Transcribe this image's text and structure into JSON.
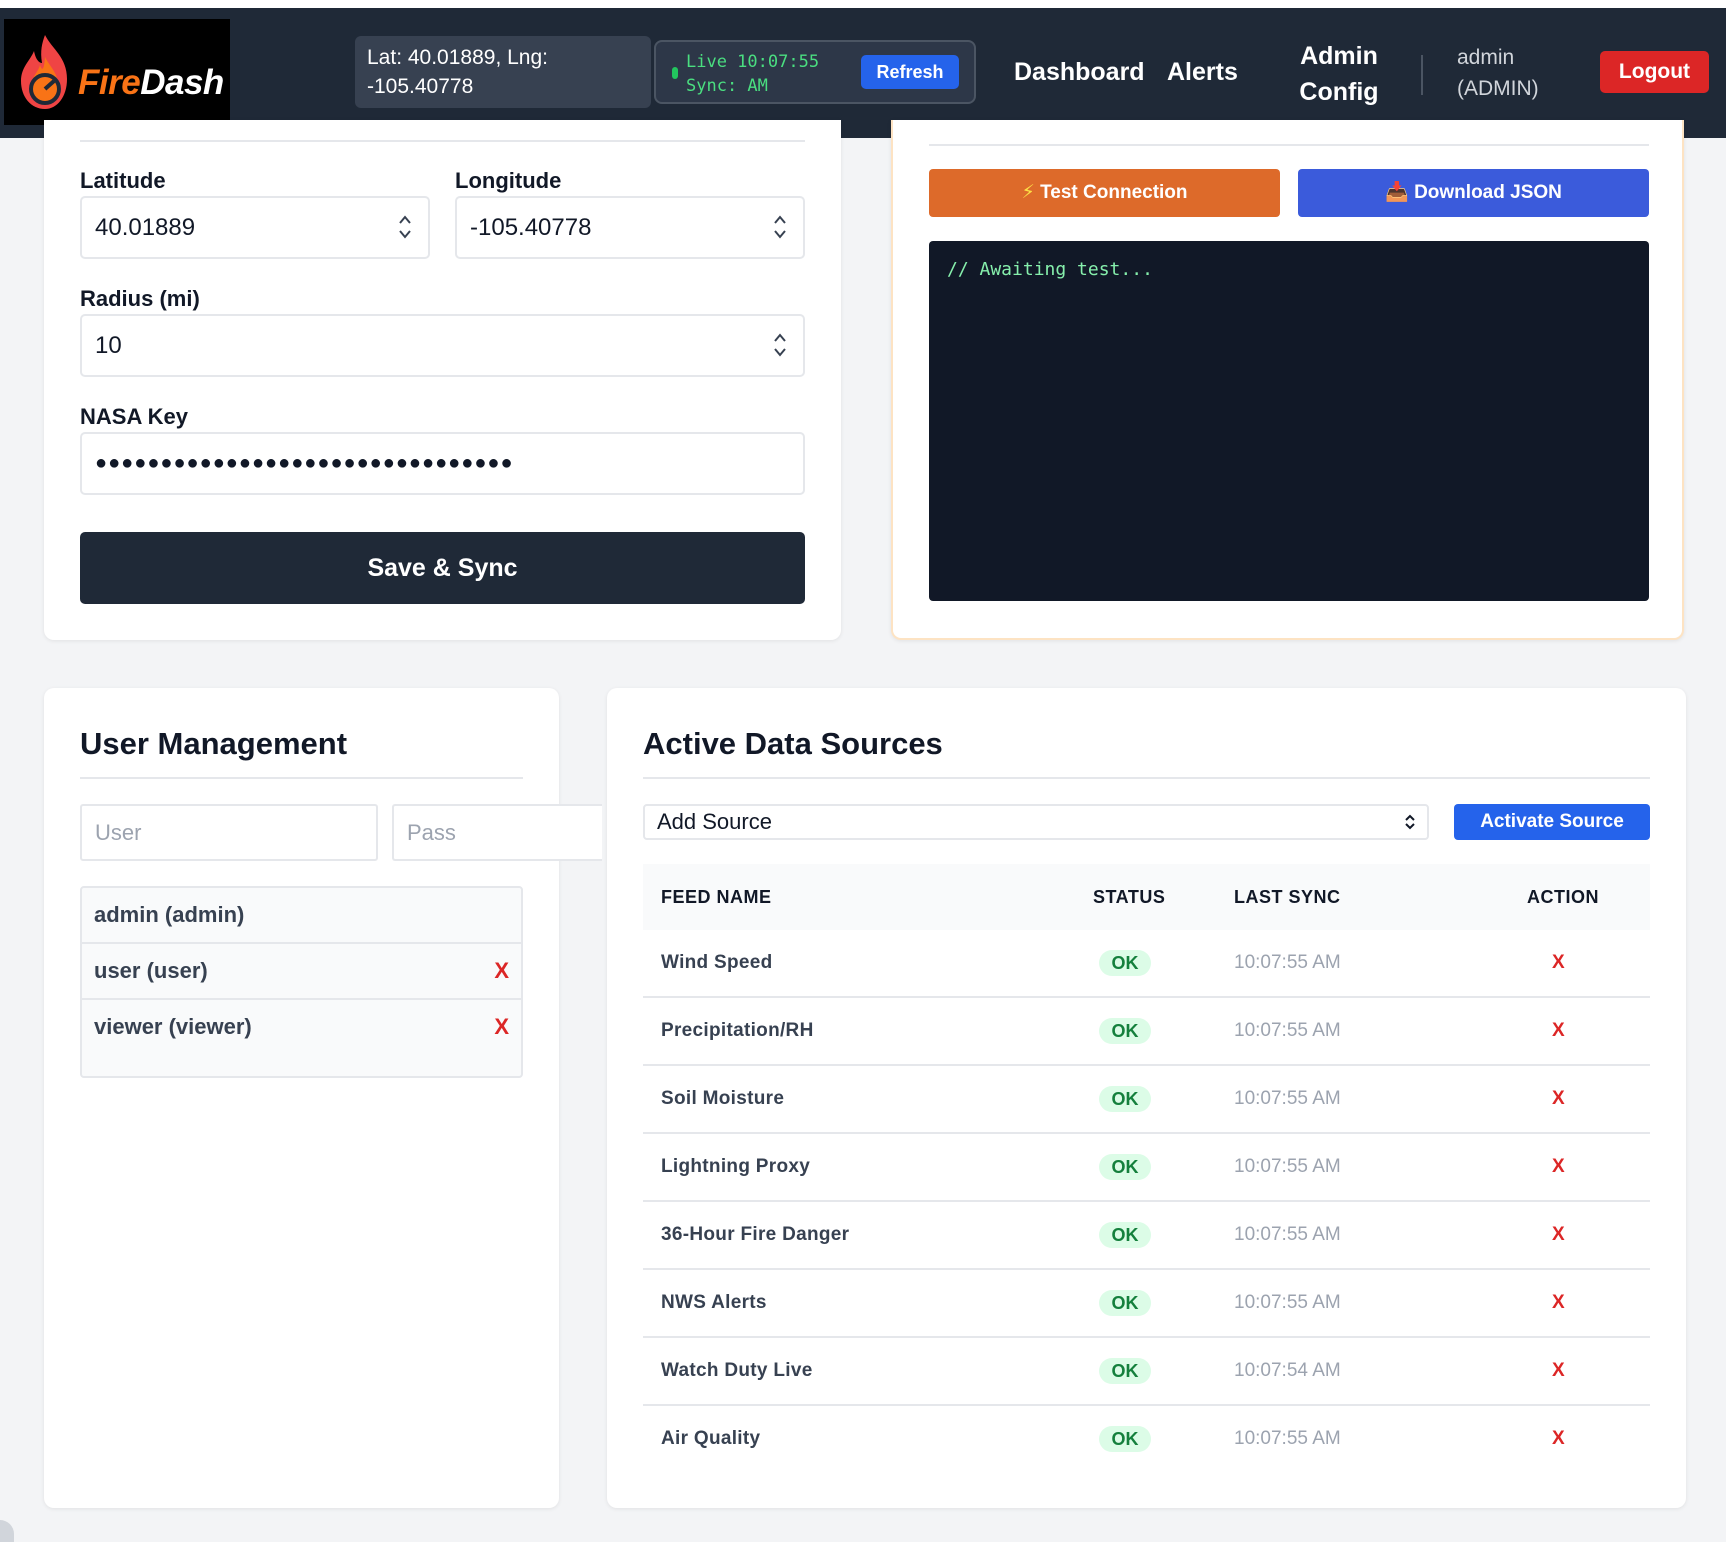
{
  "brand": {
    "name_part1": "Fire",
    "name_part2": "Dash",
    "icon": "flame-gauge-icon"
  },
  "header": {
    "coords_line1": "Lat: 40.01889, Lng:",
    "coords_line2": "-105.40778",
    "live_sync": "Live 10:07:55\nSync: AM",
    "refresh_label": "Refresh",
    "nav": {
      "dashboard": "Dashboard",
      "alerts": "Alerts",
      "admin_config": "Admin Config"
    },
    "user_line1": "admin",
    "user_line2": "(ADMIN)",
    "logout_label": "Logout"
  },
  "config": {
    "latitude_label": "Latitude",
    "latitude_value": "40.01889",
    "longitude_label": "Longitude",
    "longitude_value": "-105.40778",
    "radius_label": "Radius (mi)",
    "radius_value": "10",
    "nasa_key_label": "NASA Key",
    "nasa_key_masked": "●●●●●●●●●●●●●●●●●●●●●●●●●●●●●●●●",
    "save_label": "Save & Sync"
  },
  "api": {
    "test_label": "Test Connection",
    "test_icon": "⚡",
    "download_label": "Download JSON",
    "download_icon": "📥",
    "console_text": "// Awaiting test..."
  },
  "users": {
    "title": "User Management",
    "user_placeholder": "User",
    "pass_placeholder": "Pass",
    "list": [
      {
        "label": "admin (admin)",
        "deletable": false
      },
      {
        "label": "user (user)",
        "deletable": true,
        "delete_label": "X"
      },
      {
        "label": "viewer (viewer)",
        "deletable": true,
        "delete_label": "X"
      }
    ]
  },
  "sources": {
    "title": "Active Data Sources",
    "add_source_selected": "Add Source",
    "activate_label": "Activate Source",
    "columns": [
      "FEED NAME",
      "STATUS",
      "LAST SYNC",
      "ACTION"
    ],
    "rows": [
      {
        "name": "Wind Speed",
        "status": "OK",
        "last_sync": "10:07:55 AM",
        "action": "X"
      },
      {
        "name": "Precipitation/RH",
        "status": "OK",
        "last_sync": "10:07:55 AM",
        "action": "X"
      },
      {
        "name": "Soil Moisture",
        "status": "OK",
        "last_sync": "10:07:55 AM",
        "action": "X"
      },
      {
        "name": "Lightning Proxy",
        "status": "OK",
        "last_sync": "10:07:55 AM",
        "action": "X"
      },
      {
        "name": "36-Hour Fire Danger",
        "status": "OK",
        "last_sync": "10:07:55 AM",
        "action": "X"
      },
      {
        "name": "NWS Alerts",
        "status": "OK",
        "last_sync": "10:07:55 AM",
        "action": "X"
      },
      {
        "name": "Watch Duty Live",
        "status": "OK",
        "last_sync": "10:07:54 AM",
        "action": "X"
      },
      {
        "name": "Air Quality",
        "status": "OK",
        "last_sync": "10:07:55 AM",
        "action": "X"
      }
    ]
  },
  "colors": {
    "nav_bg": "#1f2937",
    "accent_blue": "#2563eb",
    "danger_red": "#dc2626",
    "accent_orange": "#dd6a2a",
    "status_ok_bg": "#dcfce7",
    "status_ok_text": "#15803d"
  }
}
